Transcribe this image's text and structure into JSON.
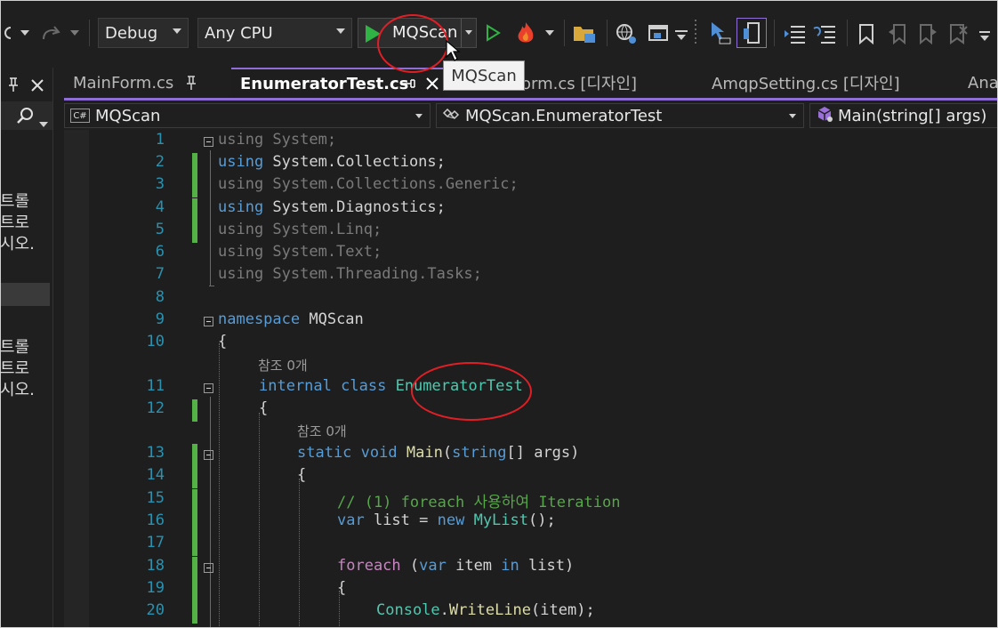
{
  "toolbar": {
    "config": "Debug",
    "platform": "Any CPU",
    "run_target": "MQScan",
    "tooltip": "MQScan"
  },
  "tabs": [
    {
      "label": "MainForm.cs",
      "pinned": true
    },
    {
      "label": "EnumeratorTest.cs",
      "active": true
    },
    {
      "label": "orm.cs [디자인]"
    },
    {
      "label": "AmqpSetting.cs [디자인]"
    },
    {
      "label": "Ana"
    }
  ],
  "left_panel": {
    "lines_a": [
      "트롤",
      "트로",
      "시오."
    ],
    "lines_b": [
      "트롤",
      "트로",
      "시오."
    ]
  },
  "navbar": {
    "project": "MQScan",
    "type": "MQScan.EnumeratorTest",
    "member": "Main(string[] args)",
    "project_icon_text": "C#"
  },
  "editor": {
    "lines": [
      {
        "n": "1",
        "code": "using System;"
      },
      {
        "n": "2",
        "code": "using System.Collections;"
      },
      {
        "n": "3",
        "code": "using System.Collections.Generic;"
      },
      {
        "n": "4",
        "code": "using System.Diagnostics;"
      },
      {
        "n": "5",
        "code": "using System.Linq;"
      },
      {
        "n": "6",
        "code": "using System.Text;"
      },
      {
        "n": "7",
        "code": "using System.Threading.Tasks;"
      },
      {
        "n": "8",
        "code": ""
      },
      {
        "n": "9",
        "code": "namespace MQScan"
      },
      {
        "n": "10",
        "code": "{"
      },
      {
        "n": "11",
        "code": "internal class EnumeratorTest"
      },
      {
        "n": "12",
        "code": "{"
      },
      {
        "n": "13",
        "code": "static void Main(string[] args)"
      },
      {
        "n": "14",
        "code": "{"
      },
      {
        "n": "15",
        "code": "// (1) foreach 사용하여 Iteration"
      },
      {
        "n": "16",
        "code": "var list = new MyList();"
      },
      {
        "n": "17",
        "code": ""
      },
      {
        "n": "18",
        "code": "foreach (var item in list)"
      },
      {
        "n": "19",
        "code": "{"
      },
      {
        "n": "20",
        "code": "Console.WriteLine(item);"
      }
    ],
    "ref_label": "참조 0개"
  },
  "colors": {
    "accent": "#8f6fd6",
    "change_bar": "#54b146",
    "annotation": "#e01e26"
  },
  "icons": [
    "debug-target-icon",
    "start-without-debug-icon",
    "hot-reload-icon",
    "folder-icon",
    "browser-link-icon",
    "bookmark-icon"
  ]
}
